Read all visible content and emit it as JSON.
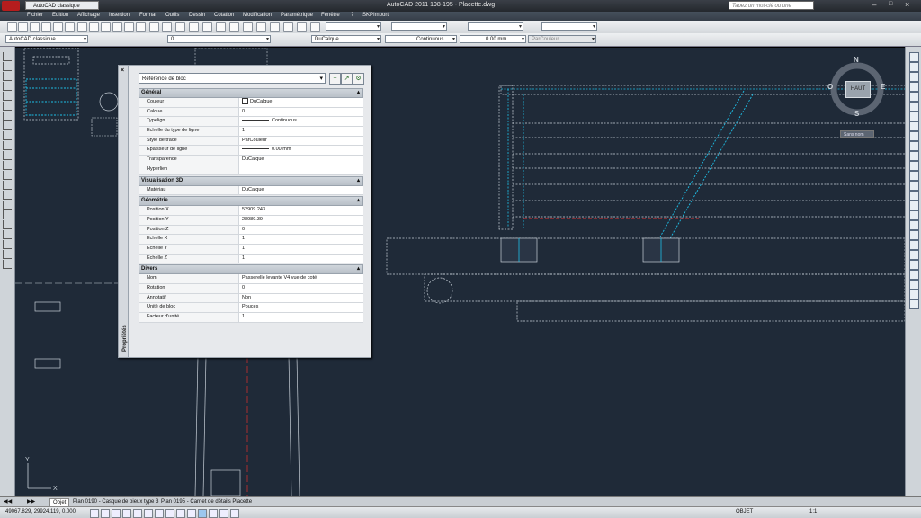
{
  "title_bar": {
    "workspace": "AutoCAD classique",
    "app_title": "AutoCAD 2011    198-195 - Placette.dwg",
    "search_placeholder": "Tapez un mot-clé ou une expression"
  },
  "menu": [
    "Fichier",
    "Edition",
    "Affichage",
    "Insertion",
    "Format",
    "Outils",
    "Dessin",
    "Cotation",
    "Modification",
    "Paramétrique",
    "Fenêtre",
    "?",
    "SKPImport"
  ],
  "toolbar2": {
    "workspace": "AutoCAD classique",
    "layer": "0",
    "color": "DuCalque",
    "linetype": "Continuous",
    "lineweight": "0.00 mm",
    "plotstyle": "ParCouleur"
  },
  "properties": {
    "palette_label": "Propriétés",
    "selection": "Référence de bloc",
    "sections": [
      {
        "name": "Général",
        "rows": [
          {
            "k": "Couleur",
            "v": "DuCalque",
            "swatch": true
          },
          {
            "k": "Calque",
            "v": "0"
          },
          {
            "k": "Typelign",
            "v": "Continuous",
            "line": true
          },
          {
            "k": "Echelle du type de ligne",
            "v": "1"
          },
          {
            "k": "Style de tracé",
            "v": "ParCouleur"
          },
          {
            "k": "Epaisseur de ligne",
            "v": "0.00 mm",
            "line": true
          },
          {
            "k": "Transparence",
            "v": "DuCalque"
          },
          {
            "k": "Hyperlien",
            "v": ""
          }
        ]
      },
      {
        "name": "Visualisation 3D",
        "rows": [
          {
            "k": "Matériau",
            "v": "DuCalque"
          }
        ]
      },
      {
        "name": "Géométrie",
        "rows": [
          {
            "k": "Position X",
            "v": "52909.243"
          },
          {
            "k": "Position Y",
            "v": "28989.39"
          },
          {
            "k": "Position Z",
            "v": "0"
          },
          {
            "k": "Echelle X",
            "v": "1"
          },
          {
            "k": "Echelle Y",
            "v": "1"
          },
          {
            "k": "Echelle Z",
            "v": "1"
          }
        ]
      },
      {
        "name": "Divers",
        "rows": [
          {
            "k": "Nom",
            "v": "Passerelle levante V4 vue de coté"
          },
          {
            "k": "Rotation",
            "v": "0"
          },
          {
            "k": "Annotatif",
            "v": "Non"
          },
          {
            "k": "Unité de bloc",
            "v": "Pouces"
          },
          {
            "k": "Facteur d'unité",
            "v": "1"
          }
        ]
      }
    ]
  },
  "compass": {
    "n": "N",
    "s": "S",
    "e": "E",
    "o": "O",
    "cube_face": "HAUT",
    "ucs_button": "Sans nom"
  },
  "tabs": [
    "Objet",
    "Plan 0190 - Casque de pieux type 3",
    "Plan 0195 - Carnet de détails Placette"
  ],
  "status": {
    "coords": "49067.829, 29924.119, 0.000",
    "mode": "OBJET",
    "scale": "1:1"
  },
  "colors": {
    "canvas": "#1f2a38",
    "cyan": "#1ec0e8",
    "red": "#e03030"
  }
}
